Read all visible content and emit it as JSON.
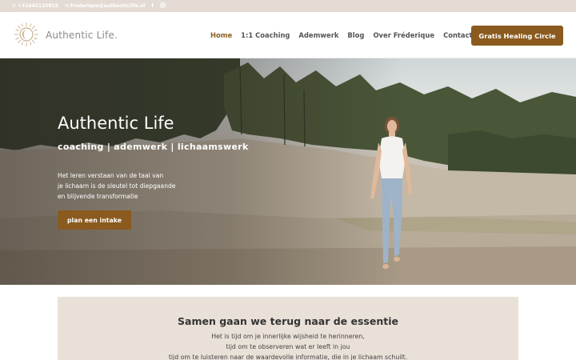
{
  "topbar": {
    "phone": "+31642125815",
    "email": "frederique@authenticlife.nl",
    "phone_icon": "phone-icon",
    "email_icon": "envelope-icon",
    "social": [
      "facebook-icon",
      "instagram-icon"
    ]
  },
  "header": {
    "logo_text": "Authentic Life.",
    "nav": [
      "Home",
      "1:1 Coaching",
      "Ademwerk",
      "Blog",
      "Over Fréderique",
      "Contact"
    ],
    "cta_label": "Gratis Healing Circle"
  },
  "hero": {
    "title": "Authentic Life",
    "subtitle": "coaching | ademwerk | lichaamswerk",
    "text_lines": [
      "Het leren verstaan van de taal van",
      "je lichaam is de sleutel tot diepgaande",
      "en blijvende transformatie"
    ],
    "button_label": "plan een intake"
  },
  "section": {
    "heading": "Samen gaan we terug naar de essentie",
    "lines": [
      "Het is tijd om je innerlijke wijsheid te herinneren,",
      "tijd om te observeren wat er leeft in jou",
      "tijd om te luisteren naar de waardevolle informatie, die in je lichaam schuilt."
    ]
  },
  "colors": {
    "accent": "#8a5a1e",
    "topbar_bg": "#e3dbd3",
    "section_bg": "#e9e0d8",
    "active_nav": "#8a5e22"
  }
}
